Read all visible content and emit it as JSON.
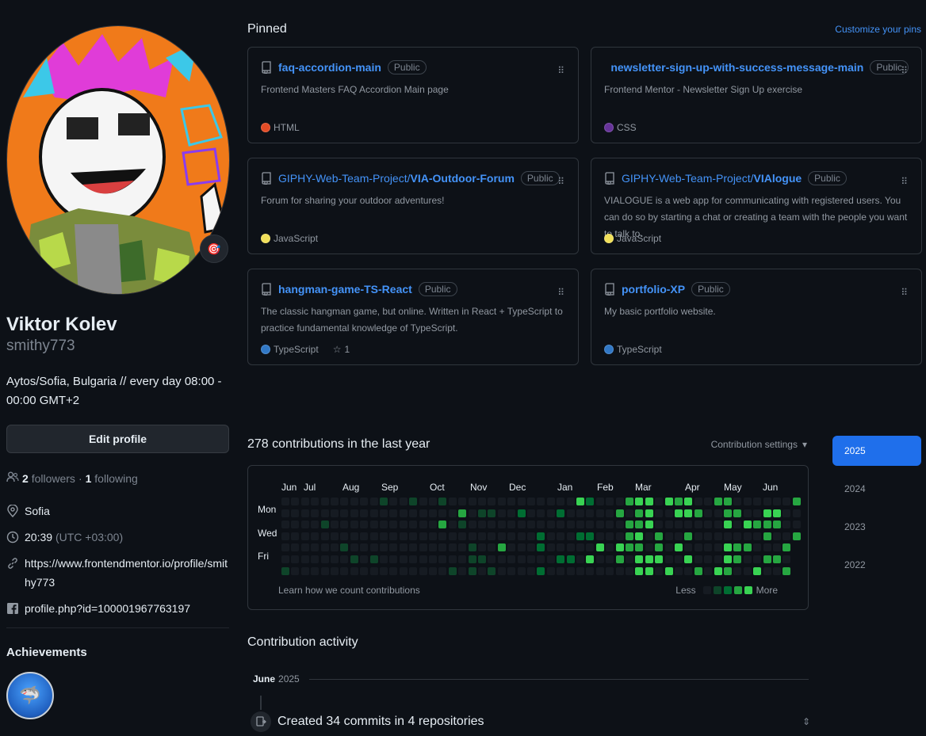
{
  "profile": {
    "name": "Viktor Kolev",
    "login": "smithy773",
    "bio": "Aytos/Sofia, Bulgaria // every day 08:00 - 00:00 GMT+2",
    "edit_label": "Edit profile",
    "followers_count": "2",
    "followers_label": "followers",
    "following_count": "1",
    "following_label": "following",
    "location": "Sofia",
    "local_time": "20:39",
    "timezone": "(UTC +03:00)",
    "website": "https://www.frontendmentor.io/profile/smithy773",
    "facebook": "profile.php?id=100001967763197",
    "achievements_title": "Achievements"
  },
  "pinned": {
    "title": "Pinned",
    "customize_label": "Customize your pins",
    "repos": [
      {
        "owner": "",
        "name": "faq-accordion-main",
        "visibility": "Public",
        "description": "Frontend Masters FAQ Accordion Main page",
        "language": "HTML",
        "language_color": "#e34c26",
        "stars": ""
      },
      {
        "owner": "",
        "name": "newsletter-sign-up-with-success-message-main",
        "visibility": "Public",
        "description": "Frontend Mentor - Newsletter Sign Up exercise",
        "language": "CSS",
        "language_color": "#663399",
        "stars": ""
      },
      {
        "owner": "GIPHY-Web-Team-Project/",
        "name": "VIA-Outdoor-Forum",
        "visibility": "Public",
        "description": "Forum for sharing your outdoor adventures!",
        "language": "JavaScript",
        "language_color": "#f1e05a",
        "stars": ""
      },
      {
        "owner": "GIPHY-Web-Team-Project/",
        "name": "VIAlogue",
        "visibility": "Public",
        "description": "VIALOGUE is a web app for communicating with registered users. You can do so by starting a chat or creating a team with the people you want to talk to.",
        "language": "JavaScript",
        "language_color": "#f1e05a",
        "stars": ""
      },
      {
        "owner": "",
        "name": "hangman-game-TS-React",
        "visibility": "Public",
        "description": "The classic hangman game, but online. Written in React + TypeScript to practice fundamental knowledge of TypeScript.",
        "language": "TypeScript",
        "language_color": "#3178c6",
        "stars": "1"
      },
      {
        "owner": "",
        "name": "portfolio-XP",
        "visibility": "Public",
        "description": "My basic portfolio website.",
        "language": "TypeScript",
        "language_color": "#3178c6",
        "stars": ""
      }
    ]
  },
  "contributions": {
    "title": "278 contributions in the last year",
    "settings_label": "Contribution settings",
    "months": [
      "Jun",
      "Jul",
      "Aug",
      "Sep",
      "Oct",
      "Nov",
      "Dec",
      "Jan",
      "Feb",
      "Mar",
      "Apr",
      "May",
      "Jun"
    ],
    "days": [
      "Mon",
      "Wed",
      "Fri"
    ],
    "learn_label": "Learn how we count contributions",
    "less_label": "Less",
    "more_label": "More",
    "level_colors": [
      "#161b22",
      "#0e4429",
      "#006d32",
      "#26a641",
      "#39d353"
    ],
    "years": [
      "2025",
      "2024",
      "2023",
      "2022"
    ],
    "active_year": "2025"
  },
  "activity": {
    "title": "Contribution activity",
    "month": "June",
    "year": "2025",
    "summary": "Created 34 commits in 4 repositories"
  }
}
